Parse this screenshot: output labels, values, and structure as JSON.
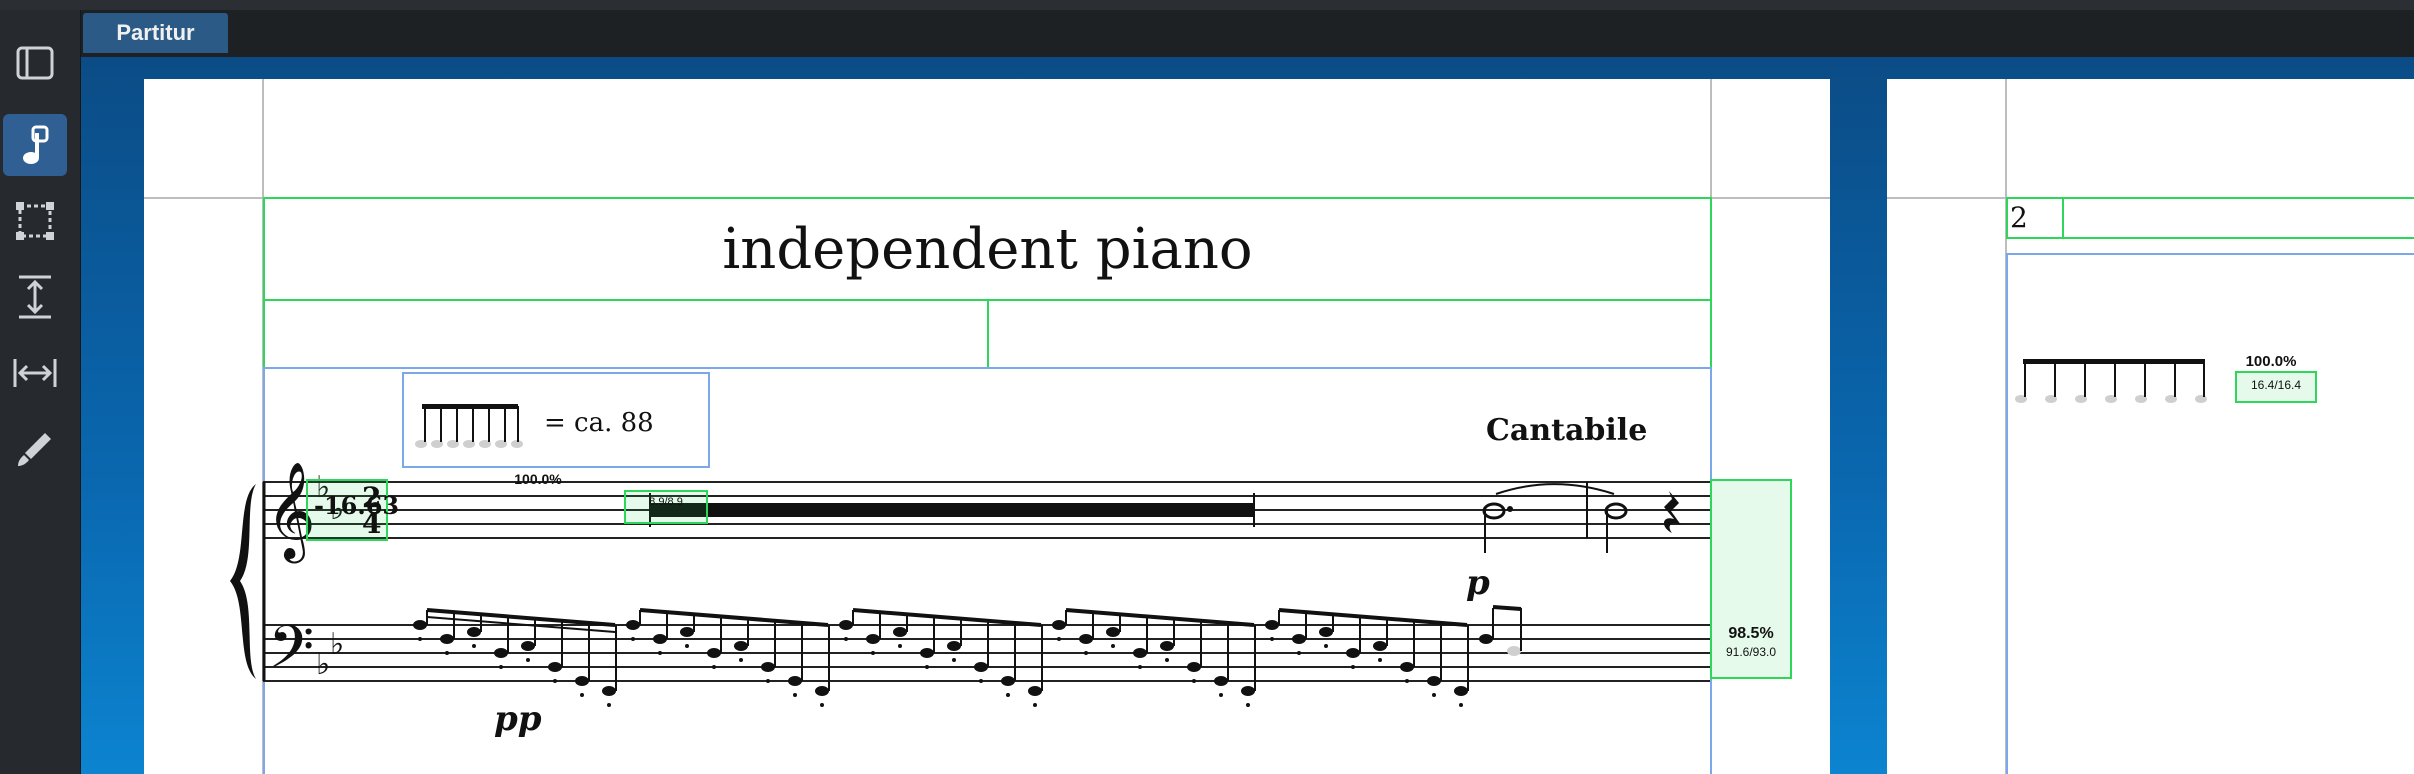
{
  "window": {
    "tab_label": "Partitur"
  },
  "toolbar": {
    "tools": [
      {
        "icon": "panel-toggle-icon",
        "active": false
      },
      {
        "icon": "note-input-icon",
        "active": true
      },
      {
        "icon": "select-box-icon",
        "active": false
      },
      {
        "icon": "vertical-spacing-icon",
        "active": false
      },
      {
        "icon": "horizontal-spacing-icon",
        "active": false
      },
      {
        "icon": "pen-icon",
        "active": false
      }
    ]
  },
  "score": {
    "title": "independent piano",
    "tempo_text": "= ca. 88",
    "expression": "Cantabile",
    "time_sig_overlap": "-16.63",
    "time_sig_top": "2",
    "time_sig_bottom": "4",
    "dynamic_treble": "p",
    "dynamic_bass": "pp",
    "rest_measure_scale": {
      "percent": "100.0%",
      "ratio": "8.9/8.9"
    },
    "system_end_scale": {
      "percent": "98.5%",
      "ratio": "91.6/93.0"
    },
    "page2": {
      "page_number": "2",
      "scale": {
        "percent": "100.0%",
        "ratio": "16.4/16.4"
      }
    }
  },
  "colors": {
    "accent": "#2f5f93",
    "frame_green": "#2ed65a",
    "frame_blue": "#7aa8ea"
  }
}
